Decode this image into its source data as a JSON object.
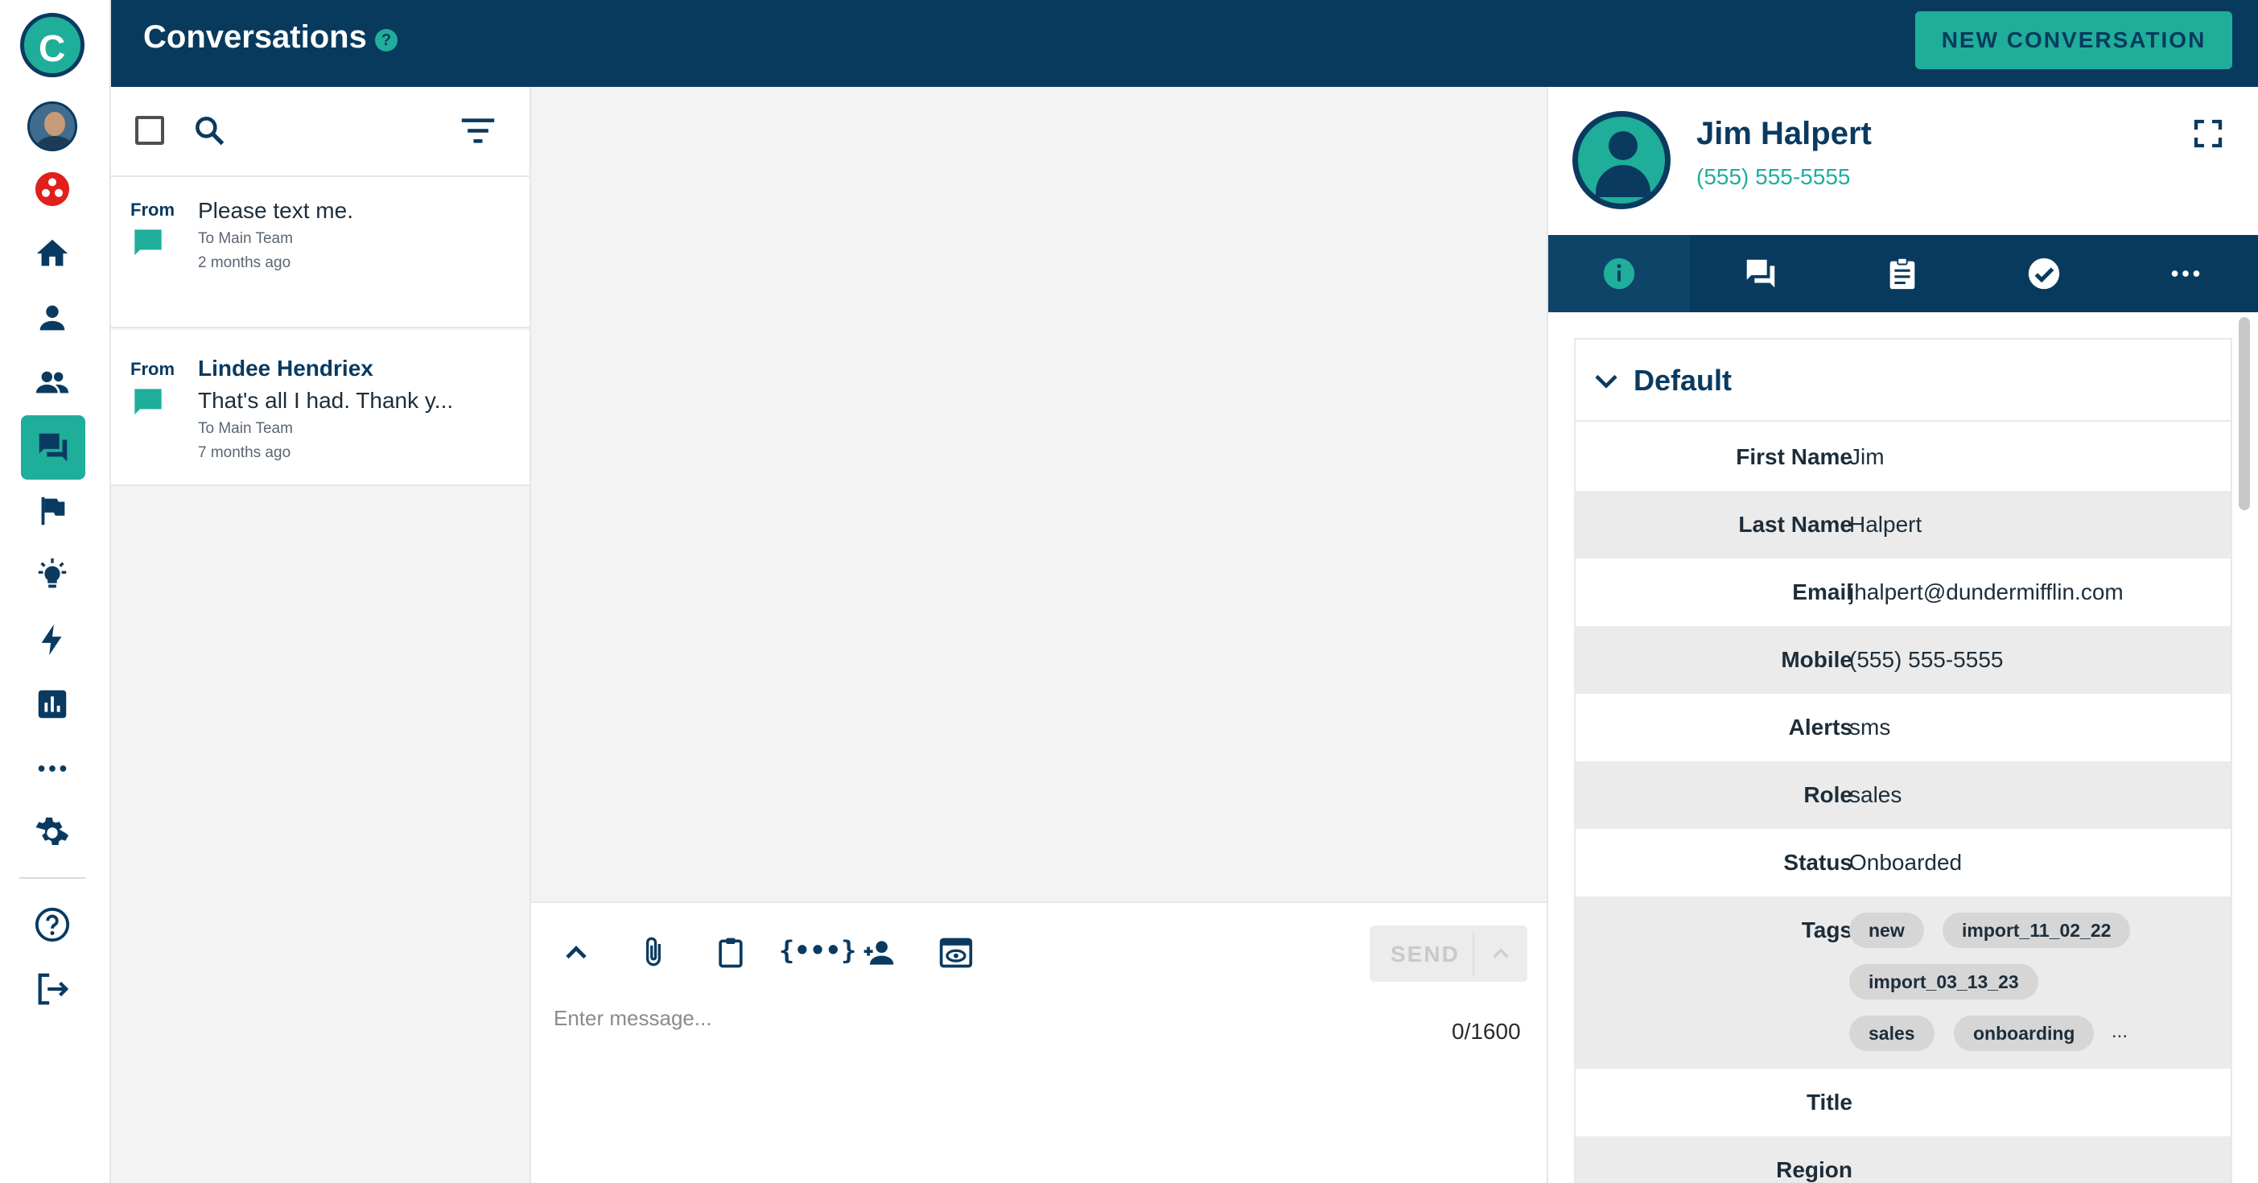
{
  "app": {
    "logo_icon": "brand-c-logo",
    "colors": {
      "brand_navy": "#083a5e",
      "brand_teal": "#1fae9a",
      "alert_red": "#e0201b"
    }
  },
  "rail": {
    "items": [
      {
        "icon": "user-avatar"
      },
      {
        "icon": "red-dots-icon"
      },
      {
        "icon": "home-icon"
      },
      {
        "icon": "person-icon"
      },
      {
        "icon": "people-icon"
      },
      {
        "icon": "chat-icon",
        "active": true
      },
      {
        "icon": "flag-icon"
      },
      {
        "icon": "lightbulb-icon"
      },
      {
        "icon": "lightning-icon"
      },
      {
        "icon": "chart-icon"
      },
      {
        "icon": "more-horizontal-icon"
      },
      {
        "icon": "gear-icon"
      },
      {
        "icon": "help-icon"
      },
      {
        "icon": "logout-icon"
      }
    ]
  },
  "header": {
    "title": "Conversations",
    "help_glyph": "?",
    "new_button": "NEW CONVERSATION"
  },
  "conversations": [
    {
      "from_label": "From",
      "sender": "",
      "message": "Please text me.",
      "to": "To Main Team",
      "time": "2 months ago"
    },
    {
      "from_label": "From",
      "sender": "Lindee Hendriex",
      "message": "That's all I had. Thank y...",
      "to": "To Main Team",
      "time": "7 months ago"
    }
  ],
  "composer": {
    "placeholder": "Enter message...",
    "counter": "0/1600",
    "send_label": "SEND",
    "variables_glyph": "{•••}"
  },
  "contact": {
    "name": "Jim Halpert",
    "phone": "(555) 555-5555",
    "tabs": [
      {
        "icon": "info-icon",
        "active": true
      },
      {
        "icon": "chat-icon"
      },
      {
        "icon": "clipboard-icon"
      },
      {
        "icon": "check-circle-icon"
      },
      {
        "icon": "more-horizontal-icon"
      }
    ],
    "section_title": "Default",
    "fields": [
      {
        "label": "First Name",
        "value": "Jim"
      },
      {
        "label": "Last Name",
        "value": "Halpert"
      },
      {
        "label": "Email",
        "value": "jhalpert@dundermifflin.com"
      },
      {
        "label": "Mobile",
        "value": "(555) 555-5555"
      },
      {
        "label": "Alerts",
        "value": "sms"
      },
      {
        "label": "Role",
        "value": "sales"
      },
      {
        "label": "Status",
        "value": "Onboarded"
      },
      {
        "label": "Tags",
        "value": ""
      },
      {
        "label": "Title",
        "value": ""
      },
      {
        "label": "Region",
        "value": ""
      }
    ],
    "tags": [
      "new",
      "import_11_02_22",
      "import_03_13_23",
      "sales",
      "onboarding"
    ],
    "tags_more": "..."
  }
}
